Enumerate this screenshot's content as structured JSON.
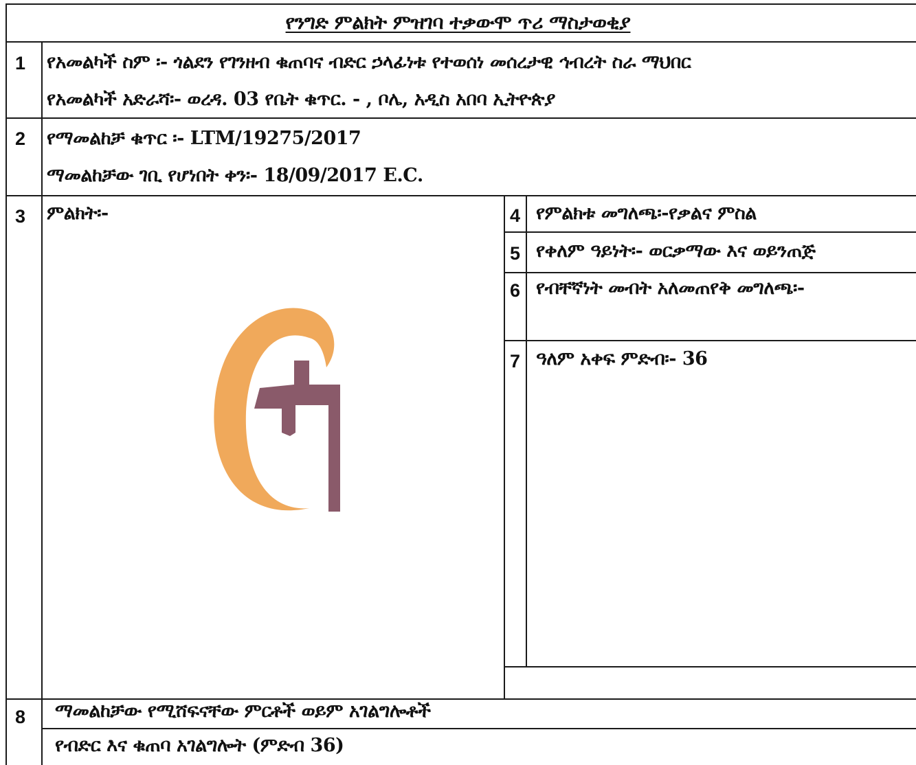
{
  "title": "የንግድ ምልክት ምዝገባ ተቃውሞ ጥሪ ማስታወቂያ",
  "rows": {
    "r1": {
      "num": "1",
      "applicant_name": "የአመልካች ስም ፡- ጎልደን የገንዘብ ቁጠባና ብድር ኃላፊነቱ የተወሰነ መሰረታዊ  ኅብረት ስራ ማህበር",
      "applicant_address": "የአመልካች አድራሻ፡- ወረዳ. 03 የቤት ቁጥር. -  , ቦሌ, አዲስ አበባ ኢትዮጵያ"
    },
    "r2": {
      "num": "2",
      "application_number": "የማመልከቻ ቁጥር ፡- LTM/19275/2017",
      "filing_date": "ማመልከቻው ገቢ የሆነበት ቀን፡- 18/09/2017 E.C."
    },
    "r3": {
      "num": "3",
      "label": "ምልክት፡-"
    },
    "r4": {
      "num": "4",
      "label": "የምልክቱ መግለጫ፡-የቃልና ምስል"
    },
    "r5": {
      "num": "5",
      "label": "የቀለም ዓይነት፡- ወርቃማው እና ወይንጠጅ"
    },
    "r6": {
      "num": "6",
      "label": "የብቸኛነት መብት አለመጠየቅ መግለጫ፡-"
    },
    "r7": {
      "num": "7",
      "label": "ዓለም አቀፍ ምድብ፡- 36"
    },
    "r8": {
      "num": "8",
      "label": "ማመልከቻው የሚሸፍናቸው ምርቶች ወይም አገልግሎቶች",
      "services": "የብድር እና ቁጠባ አገልግሎት (ምድብ 36)"
    }
  },
  "mark_logo": {
    "icon": "golden-savings-logo",
    "colors": {
      "gold": "#f0a95b",
      "plum": "#8a5a6a"
    }
  }
}
